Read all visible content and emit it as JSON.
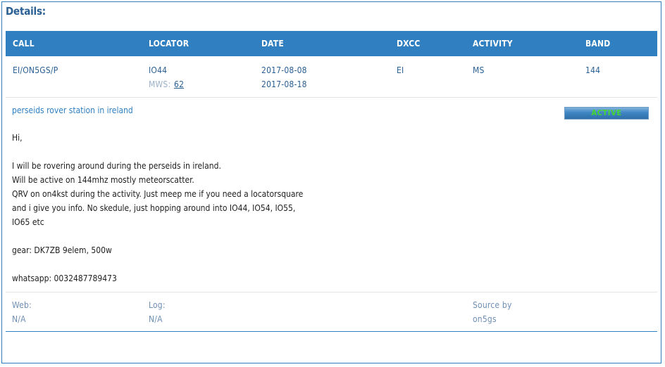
{
  "title": "Details:",
  "columns": {
    "call": "CALL",
    "locator": "LOCATOR",
    "date": "DATE",
    "dxcc": "DXCC",
    "activity": "ACTIVITY",
    "band": "BAND"
  },
  "row": {
    "call": "EI/ON5GS/P",
    "locator": "IO44",
    "mws_label": "MWS:",
    "mws_value": "62",
    "date_start": "2017-08-08",
    "date_end": "2017-08-18",
    "dxcc": "EI",
    "activity": "MS",
    "band": "144"
  },
  "subject": "perseids rover station in ireland",
  "status": "ACTIVE",
  "message_lines": [
    "Hi,",
    "",
    "I will be rovering around during the perseids in ireland.",
    "Will be active on 144mhz mostly meteorscatter.",
    "QRV on on4kst during the activity. Just meep me if you need a locatorsquare",
    "and i give you info. No skedule, just hopping around into IO44, IO54, IO55,",
    "IO65 etc",
    "",
    "gear: DK7ZB 9elem, 500w",
    "",
    "whatsapp: 0032487789473"
  ],
  "footer": {
    "web_label": "Web:",
    "web_value": "N/A",
    "log_label": "Log:",
    "log_value": "N/A",
    "source_label": "Source by",
    "source_value": "on5gs"
  },
  "colors": {
    "accent": "#2f7fc1",
    "status_text": "#45d62f"
  }
}
